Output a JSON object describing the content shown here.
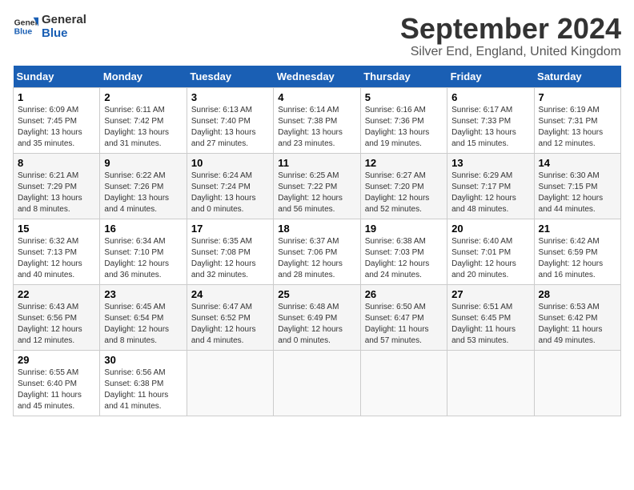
{
  "logo": {
    "line1": "General",
    "line2": "Blue"
  },
  "title": "September 2024",
  "subtitle": "Silver End, England, United Kingdom",
  "days_of_week": [
    "Sunday",
    "Monday",
    "Tuesday",
    "Wednesday",
    "Thursday",
    "Friday",
    "Saturday"
  ],
  "weeks": [
    [
      {
        "day": "1",
        "info": "Sunrise: 6:09 AM\nSunset: 7:45 PM\nDaylight: 13 hours\nand 35 minutes."
      },
      {
        "day": "2",
        "info": "Sunrise: 6:11 AM\nSunset: 7:42 PM\nDaylight: 13 hours\nand 31 minutes."
      },
      {
        "day": "3",
        "info": "Sunrise: 6:13 AM\nSunset: 7:40 PM\nDaylight: 13 hours\nand 27 minutes."
      },
      {
        "day": "4",
        "info": "Sunrise: 6:14 AM\nSunset: 7:38 PM\nDaylight: 13 hours\nand 23 minutes."
      },
      {
        "day": "5",
        "info": "Sunrise: 6:16 AM\nSunset: 7:36 PM\nDaylight: 13 hours\nand 19 minutes."
      },
      {
        "day": "6",
        "info": "Sunrise: 6:17 AM\nSunset: 7:33 PM\nDaylight: 13 hours\nand 15 minutes."
      },
      {
        "day": "7",
        "info": "Sunrise: 6:19 AM\nSunset: 7:31 PM\nDaylight: 13 hours\nand 12 minutes."
      }
    ],
    [
      {
        "day": "8",
        "info": "Sunrise: 6:21 AM\nSunset: 7:29 PM\nDaylight: 13 hours\nand 8 minutes."
      },
      {
        "day": "9",
        "info": "Sunrise: 6:22 AM\nSunset: 7:26 PM\nDaylight: 13 hours\nand 4 minutes."
      },
      {
        "day": "10",
        "info": "Sunrise: 6:24 AM\nSunset: 7:24 PM\nDaylight: 13 hours\nand 0 minutes."
      },
      {
        "day": "11",
        "info": "Sunrise: 6:25 AM\nSunset: 7:22 PM\nDaylight: 12 hours\nand 56 minutes."
      },
      {
        "day": "12",
        "info": "Sunrise: 6:27 AM\nSunset: 7:20 PM\nDaylight: 12 hours\nand 52 minutes."
      },
      {
        "day": "13",
        "info": "Sunrise: 6:29 AM\nSunset: 7:17 PM\nDaylight: 12 hours\nand 48 minutes."
      },
      {
        "day": "14",
        "info": "Sunrise: 6:30 AM\nSunset: 7:15 PM\nDaylight: 12 hours\nand 44 minutes."
      }
    ],
    [
      {
        "day": "15",
        "info": "Sunrise: 6:32 AM\nSunset: 7:13 PM\nDaylight: 12 hours\nand 40 minutes."
      },
      {
        "day": "16",
        "info": "Sunrise: 6:34 AM\nSunset: 7:10 PM\nDaylight: 12 hours\nand 36 minutes."
      },
      {
        "day": "17",
        "info": "Sunrise: 6:35 AM\nSunset: 7:08 PM\nDaylight: 12 hours\nand 32 minutes."
      },
      {
        "day": "18",
        "info": "Sunrise: 6:37 AM\nSunset: 7:06 PM\nDaylight: 12 hours\nand 28 minutes."
      },
      {
        "day": "19",
        "info": "Sunrise: 6:38 AM\nSunset: 7:03 PM\nDaylight: 12 hours\nand 24 minutes."
      },
      {
        "day": "20",
        "info": "Sunrise: 6:40 AM\nSunset: 7:01 PM\nDaylight: 12 hours\nand 20 minutes."
      },
      {
        "day": "21",
        "info": "Sunrise: 6:42 AM\nSunset: 6:59 PM\nDaylight: 12 hours\nand 16 minutes."
      }
    ],
    [
      {
        "day": "22",
        "info": "Sunrise: 6:43 AM\nSunset: 6:56 PM\nDaylight: 12 hours\nand 12 minutes."
      },
      {
        "day": "23",
        "info": "Sunrise: 6:45 AM\nSunset: 6:54 PM\nDaylight: 12 hours\nand 8 minutes."
      },
      {
        "day": "24",
        "info": "Sunrise: 6:47 AM\nSunset: 6:52 PM\nDaylight: 12 hours\nand 4 minutes."
      },
      {
        "day": "25",
        "info": "Sunrise: 6:48 AM\nSunset: 6:49 PM\nDaylight: 12 hours\nand 0 minutes."
      },
      {
        "day": "26",
        "info": "Sunrise: 6:50 AM\nSunset: 6:47 PM\nDaylight: 11 hours\nand 57 minutes."
      },
      {
        "day": "27",
        "info": "Sunrise: 6:51 AM\nSunset: 6:45 PM\nDaylight: 11 hours\nand 53 minutes."
      },
      {
        "day": "28",
        "info": "Sunrise: 6:53 AM\nSunset: 6:42 PM\nDaylight: 11 hours\nand 49 minutes."
      }
    ],
    [
      {
        "day": "29",
        "info": "Sunrise: 6:55 AM\nSunset: 6:40 PM\nDaylight: 11 hours\nand 45 minutes."
      },
      {
        "day": "30",
        "info": "Sunrise: 6:56 AM\nSunset: 6:38 PM\nDaylight: 11 hours\nand 41 minutes."
      },
      null,
      null,
      null,
      null,
      null
    ]
  ]
}
